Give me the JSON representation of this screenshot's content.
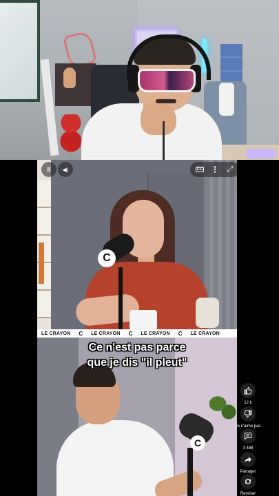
{
  "player": {
    "pause_glyph": "II",
    "volume_glyph": "◀)",
    "captions_glyph": "CC",
    "more_glyph": "⋮",
    "fullscreen_glyph": "⤢"
  },
  "ticker": {
    "items": [
      "LE CRAYON",
      "C",
      "LE CRAYON",
      "C",
      "LE CRAYON",
      "C",
      "LE CRAYON"
    ]
  },
  "mic_logo": "C",
  "caption": {
    "line1": "Ce n'est pas parce",
    "line2": "que je dis \"il pleut\""
  },
  "actions": {
    "like_count": "12 k",
    "dislike_label": "Je n'aime pas",
    "comment_count": "3 488",
    "share_label": "Partager",
    "remix_label": "Remixer"
  },
  "colors": {
    "woman_top": "#b5422c",
    "sunglasses": "#d45b8f",
    "caption_text": "#ffffff"
  }
}
